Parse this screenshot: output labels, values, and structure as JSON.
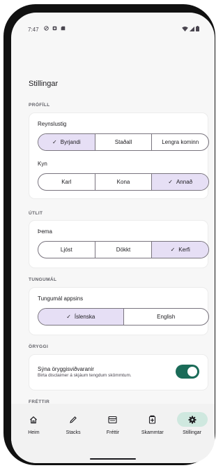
{
  "status_bar": {
    "time": "7:47",
    "left_icons": [
      "do-not-disturb-icon",
      "app-notification-icon",
      "sd-card-icon"
    ],
    "right_icons": [
      "wifi-icon",
      "signal-icon",
      "battery-icon"
    ]
  },
  "page": {
    "title": "Stillingar"
  },
  "profile": {
    "section_label": "PRÓFÍLL",
    "experience": {
      "label": "Reynslustig",
      "options": [
        "Byrjandi",
        "Staðall",
        "Lengra kominn"
      ],
      "selected": "Byrjandi"
    },
    "gender": {
      "label": "Kyn",
      "options": [
        "Karl",
        "Kona",
        "Annað"
      ],
      "selected": "Annað"
    }
  },
  "appearance": {
    "section_label": "ÚTLIT",
    "theme": {
      "label": "Þema",
      "options": [
        "Ljóst",
        "Dökkt",
        "Kerfi"
      ],
      "selected": "Kerfi"
    }
  },
  "language": {
    "section_label": "TUNGUMÁL",
    "app_language": {
      "label": "Tungumál appsins",
      "options": [
        "Íslenska",
        "English"
      ],
      "selected": "Íslenska"
    }
  },
  "safety": {
    "section_label": "ÖRYGGI",
    "show_warnings": {
      "title": "Sýna öryggisviðvaranir",
      "subtitle": "Birta disclaimer á skjáum tengdum skömmtum.",
      "enabled": true
    }
  },
  "next_section_label": "FRÉTTIR",
  "bottom_nav": {
    "items": [
      {
        "label": "Heim",
        "icon": "home-icon"
      },
      {
        "label": "Stacks",
        "icon": "pencil-icon"
      },
      {
        "label": "Fréttir",
        "icon": "news-icon"
      },
      {
        "label": "Skammtar",
        "icon": "dose-icon"
      },
      {
        "label": "Stillingar",
        "icon": "gear-icon"
      }
    ],
    "active": "Stillingar"
  },
  "colors": {
    "selected_segment": "#e6dff5",
    "toggle_on": "#1a6b58",
    "active_nav_pill": "#cfe8df"
  }
}
